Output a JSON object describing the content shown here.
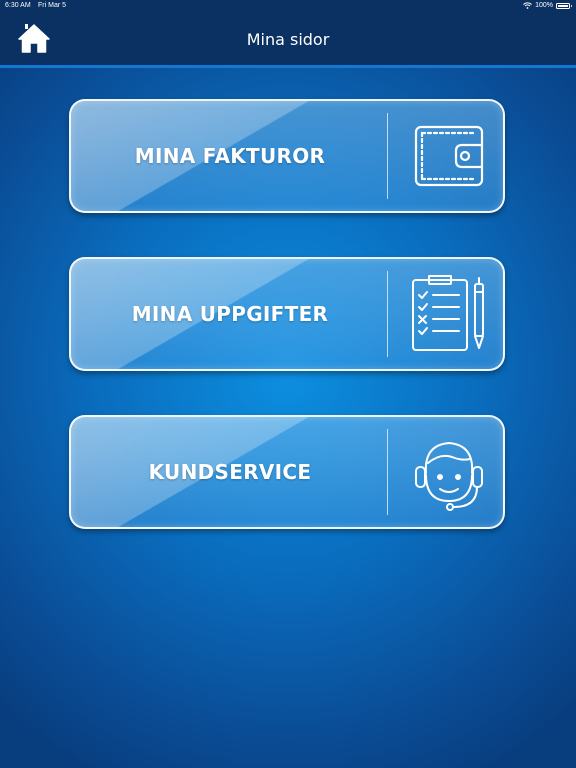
{
  "status_bar": {
    "time": "6:30 AM",
    "date": "Fri Mar 5",
    "battery": "100%"
  },
  "nav": {
    "title": "Mina sidor",
    "home_icon": "home-icon"
  },
  "menu": [
    {
      "label": "MINA FAKTUROR",
      "icon": "wallet-icon"
    },
    {
      "label": "MINA UPPGIFTER",
      "icon": "clipboard-checklist-icon"
    },
    {
      "label": "KUNDSERVICE",
      "icon": "headset-agent-icon"
    }
  ],
  "colors": {
    "nav_background": "#0a3161",
    "nav_accent": "#1378d2",
    "background_center": "#0d8fe0",
    "background_edge": "#083d7e"
  }
}
